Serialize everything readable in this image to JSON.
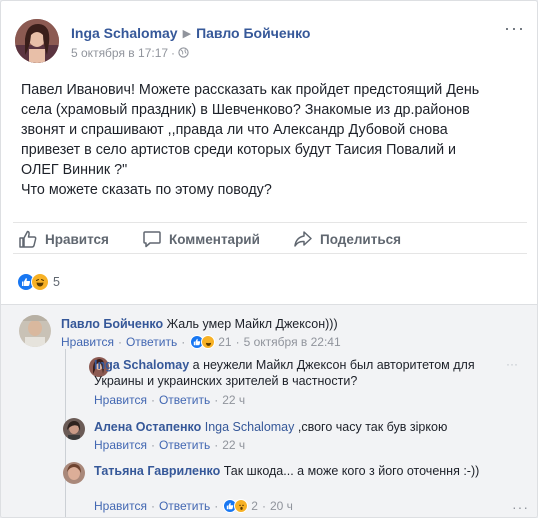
{
  "post": {
    "author": "Inga Schalomay",
    "target": "Павло Бойченко",
    "timestamp": "5 октября в 17:17",
    "privacy_icon": "globe-icon",
    "lines": [
      "Павел Иванович! Можете рассказать как пройдет предстоящий День",
      "села (храмовый праздник) в Шевченково? Знакомые из др.районов",
      "звонят и спрашивают ,,правда ли что Александр Дубовой снова",
      "привезет в село артистов среди которых будут Таисия Повалий и",
      "ОЛЕГ Винник ?\"",
      "Что можете сказать по этому поводу?"
    ]
  },
  "actions": {
    "like": "Нравится",
    "comment": "Комментарий",
    "share": "Поделиться"
  },
  "reactions": {
    "types": [
      "like",
      "haha"
    ],
    "count": "5"
  },
  "comments": [
    {
      "author": "Павло Бойченко",
      "text": "Жаль умер Майкл Джексон)))",
      "like": "Нравится",
      "reply": "Ответить",
      "reactions": [
        "like",
        "haha"
      ],
      "reaction_count": "21",
      "time": "5 октября в 22:41"
    },
    {
      "author": "Inga Schalomay",
      "text": "а неужели Майкл Джексон был авторитетом для Украины и украинских зрителей в частности?",
      "like": "Нравится",
      "reply": "Ответить",
      "time": "22 ч"
    },
    {
      "author": "Алена Остапенко",
      "tag": "Inga Schalomay",
      "text": ",свого часу так був зіркою",
      "like": "Нравится",
      "reply": "Ответить",
      "time": "22 ч"
    },
    {
      "author": "Татьяна Гавриленко",
      "text": "Так шкода... а може кого з його оточення :-))",
      "like": "Нравится",
      "reply": "Ответить",
      "reactions": [
        "like",
        "wow"
      ],
      "reaction_count": "2",
      "time": "20 ч"
    }
  ],
  "colors": {
    "link": "#365899",
    "like_blue": "#1877f2",
    "haha_yellow": "#f7b125",
    "muted": "#90949c"
  }
}
